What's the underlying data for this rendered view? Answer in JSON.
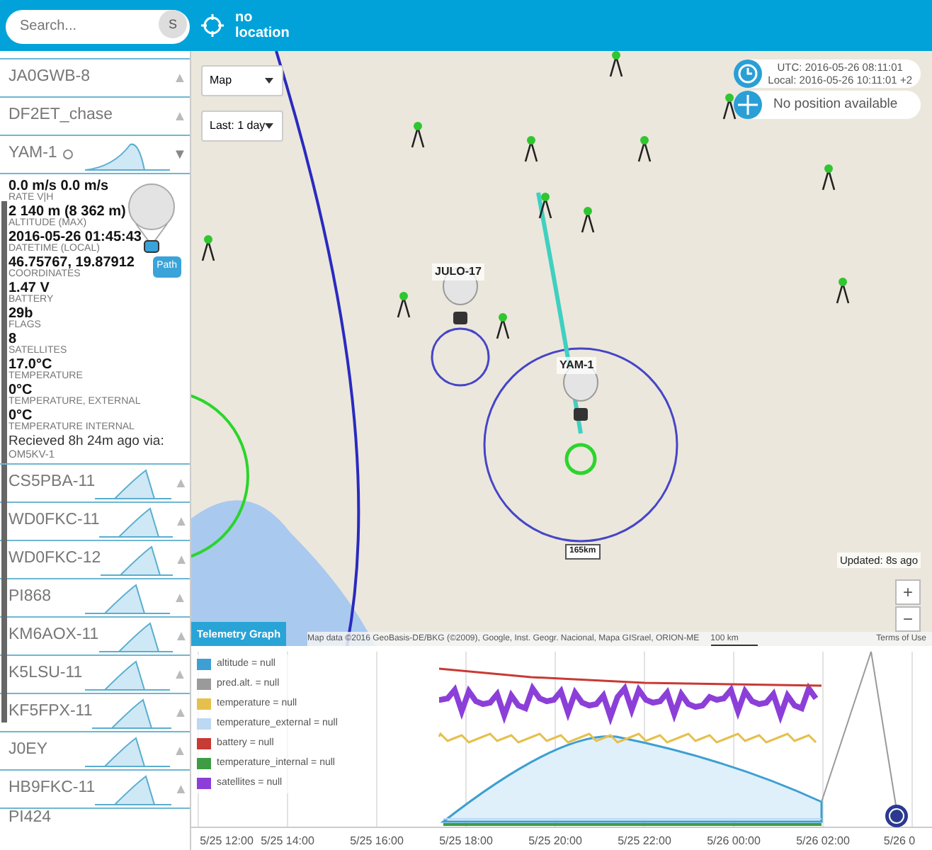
{
  "header": {
    "search": {
      "placeholder": "Search..."
    },
    "search_button": "S",
    "location": "no location"
  },
  "sidebar": {
    "items": [
      {
        "callsign": "JA0GWB-8",
        "sparkline": false,
        "expanded": false,
        "marker": false,
        "toggle": "▲"
      },
      {
        "callsign": "DF2ET_chase",
        "sparkline": false,
        "expanded": false,
        "marker": false,
        "toggle": "▲"
      },
      {
        "callsign": "YAM-1",
        "sparkline": true,
        "expanded": true,
        "marker": true,
        "toggle": "▼"
      },
      {
        "callsign": "CS5PBA-11",
        "sparkline": true,
        "expanded": false,
        "marker": false,
        "toggle": "▲"
      },
      {
        "callsign": "WD0FKC-11",
        "sparkline": true,
        "expanded": false,
        "marker": false,
        "toggle": "▲"
      },
      {
        "callsign": "WD0FKC-12",
        "sparkline": true,
        "expanded": false,
        "marker": false,
        "toggle": "▲"
      },
      {
        "callsign": "PI868",
        "sparkline": true,
        "expanded": false,
        "marker": false,
        "toggle": "▲"
      },
      {
        "callsign": "KM6AOX-11",
        "sparkline": true,
        "expanded": false,
        "marker": false,
        "toggle": "▲"
      },
      {
        "callsign": "K5LSU-11",
        "sparkline": true,
        "expanded": false,
        "marker": false,
        "toggle": "▲"
      },
      {
        "callsign": "KF5FPX-11",
        "sparkline": true,
        "expanded": false,
        "marker": false,
        "toggle": "▲"
      },
      {
        "callsign": "J0EY",
        "sparkline": true,
        "expanded": false,
        "marker": false,
        "toggle": "▲"
      },
      {
        "callsign": "HB9FKC-11",
        "sparkline": true,
        "expanded": false,
        "marker": false,
        "toggle": "▲"
      },
      {
        "callsign": "PI424",
        "sparkline": false,
        "expanded": false,
        "marker": false
      }
    ],
    "details": {
      "fields": [
        {
          "value": "0.0 m/s 0.0 m/s",
          "label": "RATE V|H"
        },
        {
          "value": "2 140 m (8 362 m)",
          "label": "ALTITUDE (MAX)"
        },
        {
          "value": "2016-05-26 01:45:43",
          "label": "DATETIME (LOCAL)"
        },
        {
          "value": "46.75767, 19.87912",
          "label": "COORDINATES"
        },
        {
          "value": "1.47 V",
          "label": "BATTERY"
        },
        {
          "value": "29b",
          "label": "FLAGS"
        },
        {
          "value": "8",
          "label": "SATELLITES"
        },
        {
          "value": "17.0°C",
          "label": "TEMPERATURE"
        },
        {
          "value": "0°C",
          "label": "TEMPERATURE, EXTERNAL"
        },
        {
          "value": "0°C",
          "label": "TEMPERATURE INTERNAL"
        }
      ],
      "received": "Recieved 8h 24m ago via:",
      "receiver": "OM5KV-1",
      "path_button": "Path"
    }
  },
  "map": {
    "type_select": "Map",
    "range_select": "Last: 1 day",
    "clock": {
      "utc": "UTC: 2016-05-26 08:11:01",
      "local": "Local: 2016-05-26 10:11:01 +2"
    },
    "position": "No position available",
    "updated": "Updated: 8s ago",
    "zoom_in": "+",
    "zoom_out": "−",
    "markers": [
      {
        "label": "JULO-17"
      },
      {
        "label": "YAM-1"
      }
    ],
    "distance": "165km",
    "attribution": "Map data ©2016 GeoBasis-DE/BKG (©2009), Google, Inst. Geogr. Nacional, Mapa GISrael, ORION-ME",
    "scale": "100 km",
    "terms": "Terms of Use"
  },
  "telemetry": {
    "tab": "Telemetry Graph",
    "legend": [
      {
        "label": "altitude = null",
        "color": "#3d9fd3"
      },
      {
        "label": "pred.alt. = null",
        "color": "#9a9a9a"
      },
      {
        "label": "temperature = null",
        "color": "#e6c04c"
      },
      {
        "label": "temperature_external = null",
        "color": "#bcd8f2"
      },
      {
        "label": "battery = null",
        "color": "#c83a34"
      },
      {
        "label": "temperature_internal = null",
        "color": "#3e9c44"
      },
      {
        "label": "satellites = null",
        "color": "#8c3fd8"
      }
    ],
    "xticks": [
      "5/25 12:00",
      "5/25 14:00",
      "5/25 16:00",
      "5/25 18:00",
      "5/25 20:00",
      "5/25 22:00",
      "5/26 00:00",
      "5/26 02:00",
      "5/26 0"
    ]
  }
}
